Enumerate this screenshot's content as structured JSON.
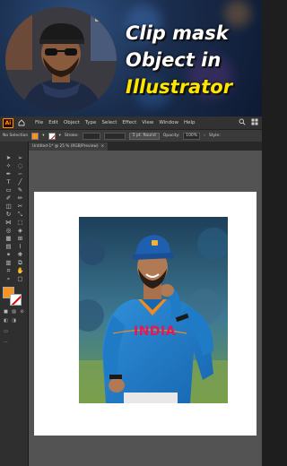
{
  "banner": {
    "title_line1": "Clip mask",
    "title_line2": "Object in",
    "title_line3": "Illustrator",
    "accent_color": "#ffe600"
  },
  "app": {
    "logo": "Ai",
    "menu": [
      "File",
      "Edit",
      "Object",
      "Type",
      "Select",
      "Effect",
      "View",
      "Window",
      "Help"
    ],
    "icons": [
      "home-icon",
      "search-icon",
      "arrange-icon"
    ]
  },
  "control_bar": {
    "selection": "No Selection",
    "fill_color": "#f7931e",
    "stroke_label": "Stroke:",
    "brush": "5 pt. Round",
    "opacity_label": "Opacity:",
    "opacity_value": "100%",
    "style_label": "Style:"
  },
  "document": {
    "tab_label": "Untitled-1* @ 25 % (RGB/Preview)",
    "close_icon": "close-icon"
  },
  "photo": {
    "jersey_text": "INDIA"
  }
}
